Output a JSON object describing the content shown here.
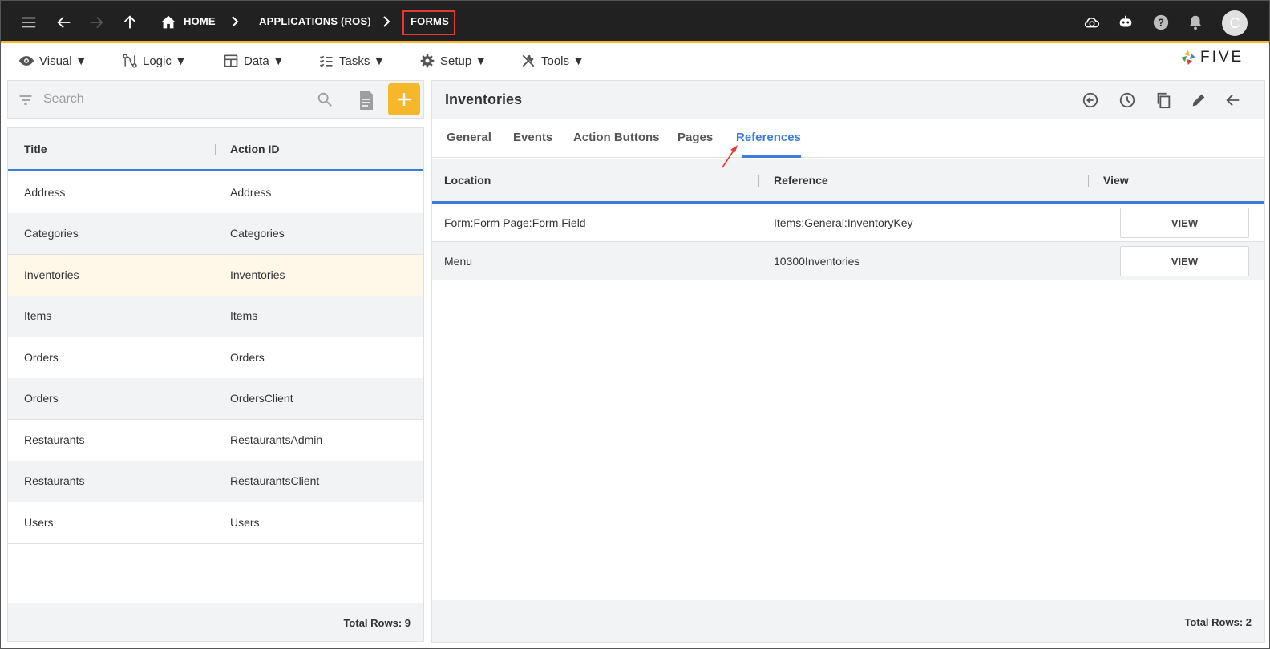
{
  "topbar": {
    "crumbs": [
      "HOME",
      "APPLICATIONS (ROS)",
      "FORMS"
    ],
    "avatar_initial": "C",
    "icons": [
      "menu-icon",
      "back-arrow-icon",
      "forward-arrow-icon",
      "up-arrow-icon",
      "home-icon",
      "cloud-check-icon",
      "chatbot-icon",
      "help-icon",
      "bell-icon"
    ]
  },
  "menubar": {
    "items": [
      "Visual ▼",
      "Logic ▼",
      "Data ▼",
      "Tasks ▼",
      "Setup ▼",
      "Tools ▼"
    ],
    "logo_text": "FIVE"
  },
  "left": {
    "search_placeholder": "Search",
    "columns": [
      "Title",
      "Action ID"
    ],
    "rows": [
      {
        "title": "Address",
        "action_id": "Address"
      },
      {
        "title": "Categories",
        "action_id": "Categories"
      },
      {
        "title": "Inventories",
        "action_id": "Inventories"
      },
      {
        "title": "Items",
        "action_id": "Items"
      },
      {
        "title": "Orders",
        "action_id": "Orders"
      },
      {
        "title": "Orders",
        "action_id": "OrdersClient"
      },
      {
        "title": "Restaurants",
        "action_id": "RestaurantsAdmin"
      },
      {
        "title": "Restaurants",
        "action_id": "RestaurantsClient"
      },
      {
        "title": "Users",
        "action_id": "Users"
      }
    ],
    "total_rows": "Total Rows: 9"
  },
  "right": {
    "title": "Inventories",
    "tabs": [
      "General",
      "Events",
      "Action Buttons",
      "Pages",
      "References"
    ],
    "active_tab": "References",
    "columns": [
      "Location",
      "Reference",
      "View"
    ],
    "rows": [
      {
        "location": "Form:Form Page:Form Field",
        "reference": "Items:General:InventoryKey",
        "view": "VIEW"
      },
      {
        "location": "Menu",
        "reference": "10300Inventories",
        "view": "VIEW"
      }
    ],
    "total_rows": "Total Rows: 2"
  },
  "colors": {
    "topbar_bg": "#212121",
    "accent": "#f6b72b",
    "active_tab": "#3b7dd8",
    "highlight_box": "#e53935",
    "selected_row": "#fff8e8"
  }
}
